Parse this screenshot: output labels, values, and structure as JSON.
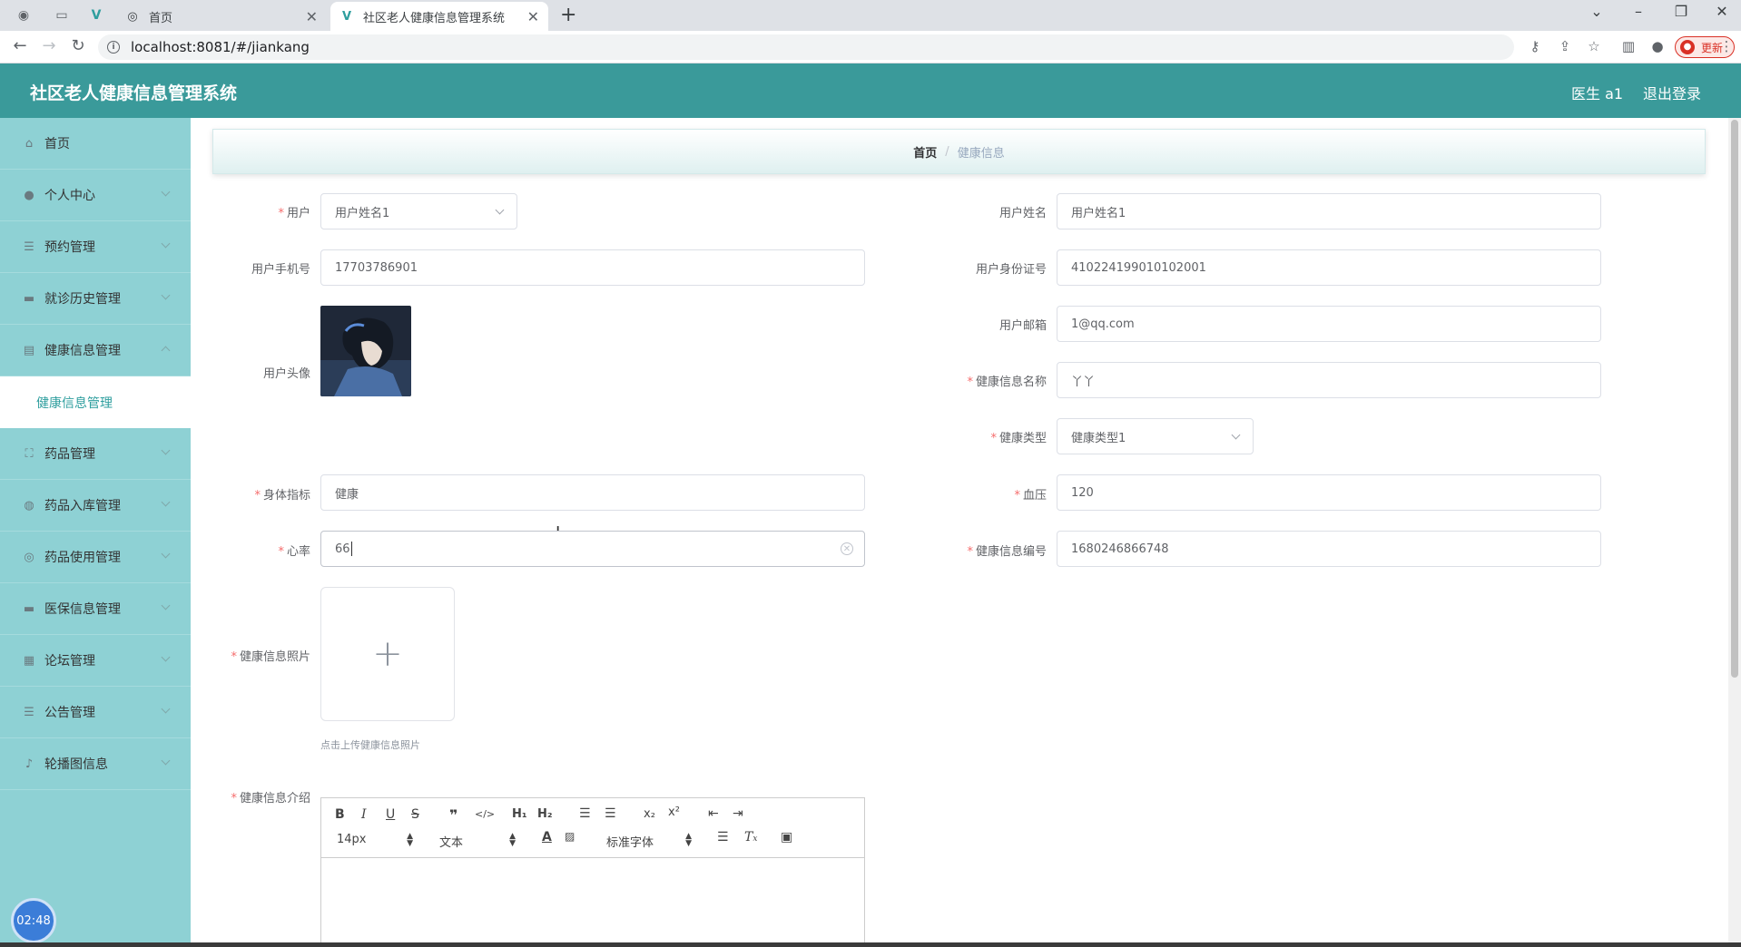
{
  "browser": {
    "tabs": [
      {
        "title": "首页",
        "active": false
      },
      {
        "title": "社区老人健康信息管理系统",
        "active": true
      }
    ],
    "url": "localhost:8081/#/jiankang",
    "update_label": "更新"
  },
  "header": {
    "title": "社区老人健康信息管理系统",
    "user": "医生 a1",
    "logout": "退出登录"
  },
  "sidebar": {
    "items": [
      {
        "label": "首页",
        "icon": "home-icon"
      },
      {
        "label": "个人中心",
        "icon": "user-icon"
      },
      {
        "label": "预约管理",
        "icon": "list-icon"
      },
      {
        "label": "就诊历史管理",
        "icon": "monitor-icon"
      },
      {
        "label": "健康信息管理",
        "icon": "document-icon",
        "expanded": true
      },
      {
        "label": "药品管理",
        "icon": "expand-icon"
      },
      {
        "label": "药品入库管理",
        "icon": "compass-icon"
      },
      {
        "label": "药品使用管理",
        "icon": "target-icon"
      },
      {
        "label": "医保信息管理",
        "icon": "chat-icon"
      },
      {
        "label": "论坛管理",
        "icon": "grid-icon"
      },
      {
        "label": "公告管理",
        "icon": "sliders-icon"
      },
      {
        "label": "轮播图信息",
        "icon": "mic-icon"
      }
    ],
    "submenu_active": "健康信息管理",
    "timer": "02:48"
  },
  "breadcrumb": {
    "home": "首页",
    "separator": "/",
    "current": "健康信息"
  },
  "form": {
    "yonghu": {
      "label": "用户",
      "value": "用户姓名1"
    },
    "yonghuxingming": {
      "label": "用户姓名",
      "value": "用户姓名1"
    },
    "shouji": {
      "label": "用户手机号",
      "value": "17703786901"
    },
    "shenfenzheng": {
      "label": "用户身份证号",
      "value": "410224199010102001"
    },
    "touxiang": {
      "label": "用户头像"
    },
    "youxiang": {
      "label": "用户邮箱",
      "value": "1@qq.com"
    },
    "mingcheng": {
      "label": "健康信息名称",
      "value": "丫丫"
    },
    "leixing": {
      "label": "健康类型",
      "value": "健康类型1"
    },
    "zhibiao": {
      "label": "身体指标",
      "value": "健康"
    },
    "xueya": {
      "label": "血压",
      "value": "120"
    },
    "xinlv": {
      "label": "心率",
      "value": "66"
    },
    "bianhao": {
      "label": "健康信息编号",
      "value": "1680246866748"
    },
    "zhaopian": {
      "label": "健康信息照片",
      "tip": "点击上传健康信息照片"
    },
    "jieshao": {
      "label": "健康信息介绍"
    }
  },
  "editor": {
    "size": "14px",
    "header": "文本",
    "font": "标准字体"
  },
  "colors": {
    "header_bg": "#3a9a9a",
    "sidebar_bg": "#8ed1d4",
    "accent": "#2e9e9e",
    "required": "#f56c6c"
  }
}
